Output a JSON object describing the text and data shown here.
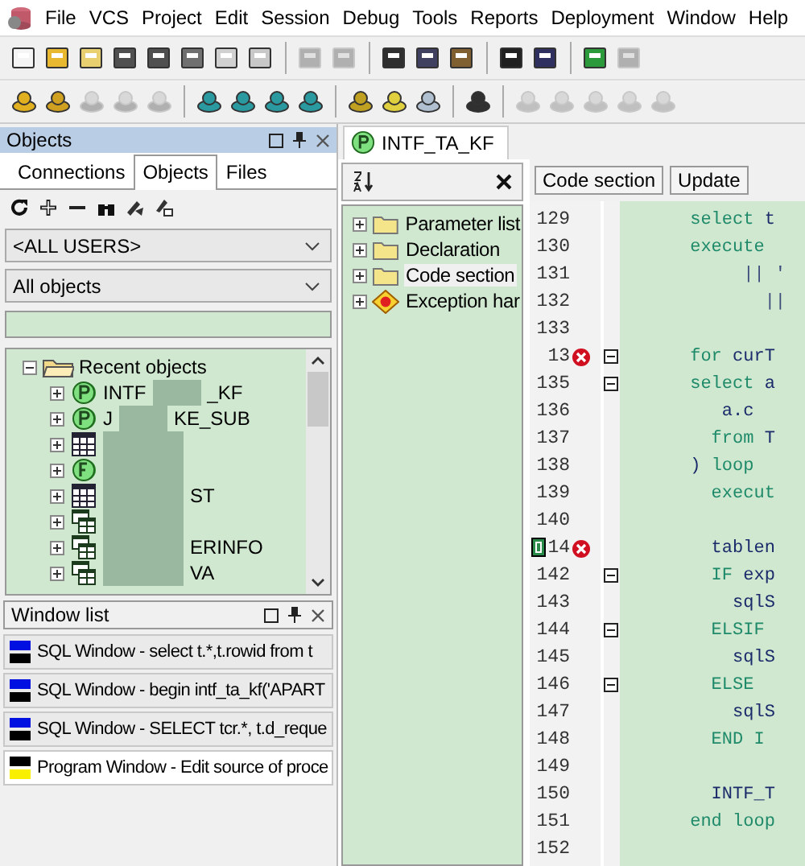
{
  "menu": [
    "File",
    "VCS",
    "Project",
    "Edit",
    "Session",
    "Debug",
    "Tools",
    "Reports",
    "Deployment",
    "Window",
    "Help"
  ],
  "objects_panel": {
    "title": "Objects",
    "tabs": [
      {
        "label": "Connections",
        "selected": false
      },
      {
        "label": "Objects",
        "selected": true
      },
      {
        "label": "Files",
        "selected": false
      }
    ],
    "user_select": "<ALL USERS>",
    "type_select": "All objects",
    "tree": {
      "label": "Recent objects",
      "expanded": true,
      "children": [
        {
          "kind": "package",
          "parts": [
            "INTF",
            "_KF"
          ]
        },
        {
          "kind": "package",
          "parts": [
            "J",
            "KE_SUB"
          ]
        },
        {
          "kind": "table"
        },
        {
          "kind": "function"
        },
        {
          "kind": "table",
          "parts": [
            "ST"
          ]
        },
        {
          "kind": "view"
        },
        {
          "kind": "view",
          "parts": [
            "ERINFO"
          ]
        },
        {
          "kind": "view",
          "parts": [
            "VA"
          ]
        }
      ]
    }
  },
  "window_list": {
    "title": "Window list",
    "items": [
      {
        "kind": "sql",
        "label": "SQL Window - select t.*,t.rowid from t",
        "selected": false
      },
      {
        "kind": "sql",
        "label": "SQL Window - begin intf_ta_kf('APART",
        "selected": false
      },
      {
        "kind": "sql",
        "label": "SQL Window - SELECT tcr.*, t.d_reque",
        "selected": false
      },
      {
        "kind": "program",
        "label": "Program Window - Edit source of proce",
        "selected": true
      }
    ]
  },
  "editor": {
    "tab": "INTF_TA_KF",
    "outline": [
      {
        "kind": "folder",
        "label": "Parameter list",
        "selected": false
      },
      {
        "kind": "folder",
        "label": "Declaration",
        "selected": false
      },
      {
        "kind": "folder",
        "label": "Code section",
        "selected": true
      },
      {
        "kind": "exception",
        "label": "Exception har",
        "selected": false
      }
    ],
    "buttons": [
      "Code section",
      "Update"
    ],
    "lines": [
      {
        "no": "129",
        "bookmark": false,
        "breakpoint": false,
        "fold": false,
        "code": [
          {
            "text": "      select",
            "kind": "keyword"
          },
          {
            "text": " t",
            "kind": "identifier"
          }
        ]
      },
      {
        "no": "130",
        "bookmark": false,
        "breakpoint": false,
        "fold": false,
        "code": [
          {
            "text": "      execute",
            "kind": "keyword"
          }
        ]
      },
      {
        "no": "131",
        "bookmark": false,
        "breakpoint": false,
        "fold": false,
        "code": [
          {
            "text": "           || '",
            "kind": "operator"
          }
        ]
      },
      {
        "no": "132",
        "bookmark": false,
        "breakpoint": false,
        "fold": false,
        "code": [
          {
            "text": "             ||",
            "kind": "operator"
          }
        ]
      },
      {
        "no": "133",
        "bookmark": false,
        "breakpoint": false,
        "fold": false
      },
      {
        "no": "13",
        "bookmark": false,
        "breakpoint": true,
        "fold": true,
        "code": [
          {
            "text": "      for",
            "kind": "keyword"
          },
          {
            "text": " curT",
            "kind": "identifier"
          }
        ]
      },
      {
        "no": "135",
        "bookmark": false,
        "breakpoint": false,
        "fold": true,
        "code": [
          {
            "text": "      select",
            "kind": "keyword"
          },
          {
            "text": " a",
            "kind": "identifier"
          }
        ]
      },
      {
        "no": "136",
        "bookmark": false,
        "breakpoint": false,
        "fold": false,
        "code": [
          {
            "text": "         a.c",
            "kind": "identifier"
          }
        ]
      },
      {
        "no": "137",
        "bookmark": false,
        "breakpoint": false,
        "fold": false,
        "code": [
          {
            "text": "        from",
            "kind": "keyword"
          },
          {
            "text": " T",
            "kind": "identifier"
          }
        ]
      },
      {
        "no": "138",
        "bookmark": false,
        "breakpoint": false,
        "fold": false,
        "code": [
          {
            "text": "      ) ",
            "kind": "identifier"
          },
          {
            "text": "loop",
            "kind": "keyword"
          }
        ]
      },
      {
        "no": "139",
        "bookmark": false,
        "breakpoint": false,
        "fold": false,
        "code": [
          {
            "text": "        execut",
            "kind": "keyword"
          }
        ]
      },
      {
        "no": "140",
        "bookmark": false,
        "breakpoint": false,
        "fold": false
      },
      {
        "no": "14",
        "bookmark": true,
        "breakpoint": true,
        "fold": false,
        "code": [
          {
            "text": "        tablen",
            "kind": "identifier"
          }
        ]
      },
      {
        "no": "142",
        "bookmark": false,
        "breakpoint": false,
        "fold": true,
        "code": [
          {
            "text": "        IF",
            "kind": "keyword"
          },
          {
            "text": " exp",
            "kind": "identifier"
          }
        ]
      },
      {
        "no": "143",
        "bookmark": false,
        "breakpoint": false,
        "fold": false,
        "code": [
          {
            "text": "          sqlS",
            "kind": "identifier"
          }
        ]
      },
      {
        "no": "144",
        "bookmark": false,
        "breakpoint": false,
        "fold": true,
        "code": [
          {
            "text": "        ELSIF",
            "kind": "keyword"
          }
        ]
      },
      {
        "no": "145",
        "bookmark": false,
        "breakpoint": false,
        "fold": false,
        "code": [
          {
            "text": "          sqlS",
            "kind": "identifier"
          }
        ]
      },
      {
        "no": "146",
        "bookmark": false,
        "breakpoint": false,
        "fold": true,
        "code": [
          {
            "text": "        ELSE",
            "kind": "keyword"
          }
        ]
      },
      {
        "no": "147",
        "bookmark": false,
        "breakpoint": false,
        "fold": false,
        "code": [
          {
            "text": "          sqlS",
            "kind": "identifier"
          }
        ]
      },
      {
        "no": "148",
        "bookmark": false,
        "breakpoint": false,
        "fold": false,
        "code": [
          {
            "text": "        END I",
            "kind": "keyword"
          }
        ]
      },
      {
        "no": "149",
        "bookmark": false,
        "breakpoint": false,
        "fold": false
      },
      {
        "no": "150",
        "bookmark": false,
        "breakpoint": false,
        "fold": false,
        "code": [
          {
            "text": "        INTF_T",
            "kind": "identifier"
          }
        ]
      },
      {
        "no": "151",
        "bookmark": false,
        "breakpoint": false,
        "fold": false,
        "code": [
          {
            "text": "      end loop",
            "kind": "keyword"
          }
        ]
      },
      {
        "no": "152",
        "bookmark": false,
        "breakpoint": false,
        "fold": false
      }
    ]
  }
}
